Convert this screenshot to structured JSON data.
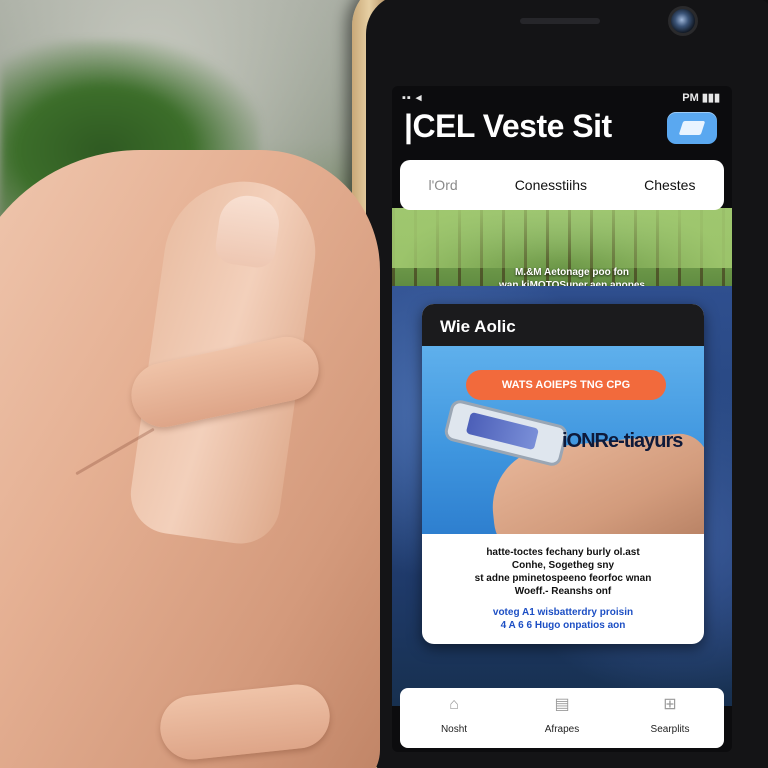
{
  "status_bar": {
    "left": "▪▪ ◂",
    "right": "PM ▮▮▮"
  },
  "app": {
    "title": "|CEL Veste Sit"
  },
  "nav": {
    "items": [
      "l'Ord",
      "Conesstiihs",
      "Chestes"
    ]
  },
  "hero": {
    "caption": "M.&M Aetonage poo fon\nwan.kiMOTOSuper.aen anopes"
  },
  "card": {
    "header": "Wie Aolic",
    "promo": "WATS AOIEPS  TNG CPG",
    "overlay": "iONRe-tiayurs",
    "body": "hatte-toctes fechany burly ol.ast\nConhe, Sogetheg sny\nst adne pminetospeeno feorfoc wnan\nWoeff.- Reanshs onf",
    "link": "voteg  A1  wisbatterdry proisin\n4 A 6 6 Hugo onpatios aon"
  },
  "tabs": [
    {
      "label": "Nosht",
      "icon": "home-icon"
    },
    {
      "label": "Afrapes",
      "icon": "bag-icon"
    },
    {
      "label": "Searplits",
      "icon": "grid-icon"
    }
  ],
  "colors": {
    "accent_blue": "#5aa8f0",
    "promo_orange": "#f26a3c",
    "link_blue": "#1d4fc4"
  }
}
